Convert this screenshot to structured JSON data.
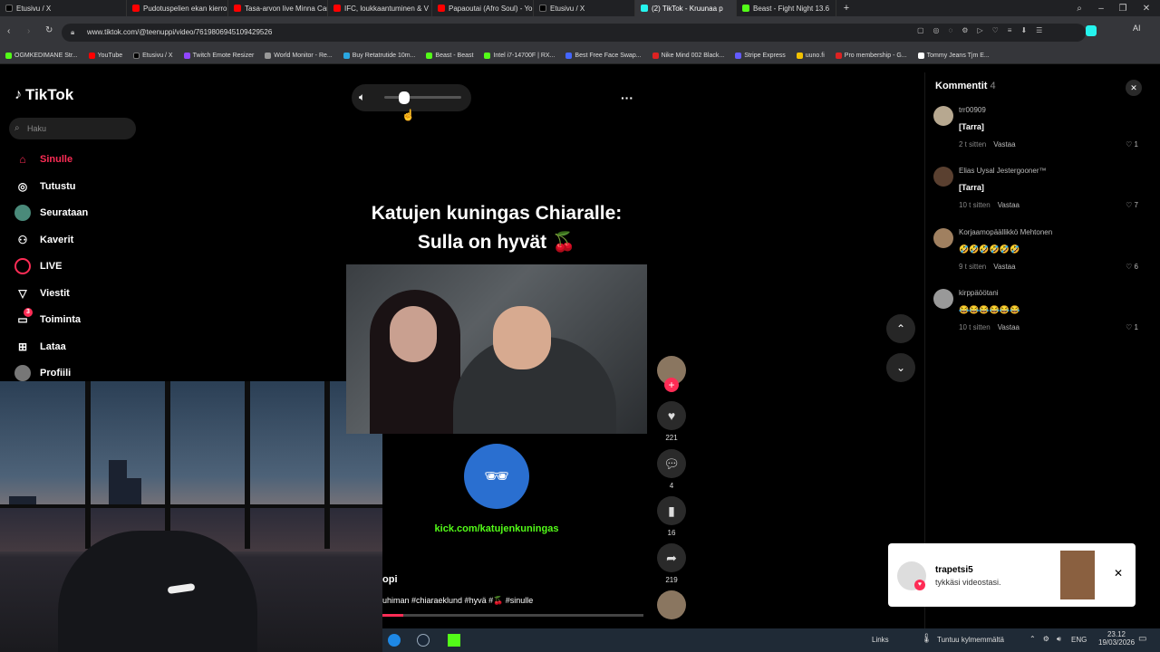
{
  "browser": {
    "tabs": [
      {
        "label": "Etusivu / X",
        "color": "#000000",
        "icon": "x-logo-icon"
      },
      {
        "label": "Pudotuspelien ekan kierro",
        "color": "#ff0000",
        "icon": "youtube-icon"
      },
      {
        "label": "Tasa-arvon live Minna Can",
        "color": "#ff0000",
        "icon": "youtube-icon"
      },
      {
        "label": "IFC, loukkaantuminen & V",
        "color": "#ff0000",
        "icon": "youtube-icon"
      },
      {
        "label": "Papaoutai (Afro Soul) - Yo",
        "color": "#ff0000",
        "icon": "youtube-icon"
      },
      {
        "label": "Etusivu / X",
        "color": "#000000",
        "icon": "x-logo-icon"
      },
      {
        "label": "(2) TikTok - Kruunaa p",
        "color": "#25f4ee",
        "icon": "tiktok-icon"
      },
      {
        "label": "Beast - Fight Night 13.6",
        "color": "#53fc18",
        "icon": "beast-icon"
      }
    ],
    "url": "www.tiktok.com/@teenuppi/video/7619806945109429526",
    "bookmarks": [
      {
        "label": "OGMKEDIMANE Str...",
        "color": "#53fc18"
      },
      {
        "label": "YouTube",
        "color": "#ff0000"
      },
      {
        "label": "Etusivu / X",
        "color": "#000000"
      },
      {
        "label": "Twitch Emote Resizer",
        "color": "#9146ff"
      },
      {
        "label": "World Monitor - Re...",
        "color": "#999999"
      },
      {
        "label": "Buy Retatrutide 10m...",
        "color": "#2aa7e1"
      },
      {
        "label": "Beast - Beast",
        "color": "#53fc18"
      },
      {
        "label": "Intel i7-14700F | RX...",
        "color": "#53fc18"
      },
      {
        "label": "Best Free Face Swap...",
        "color": "#4466ff"
      },
      {
        "label": "Nike Mind 002 Black...",
        "color": "#dd2222"
      },
      {
        "label": "Stripe Express",
        "color": "#635bff"
      },
      {
        "label": "uuno.fi",
        "color": "#f2c200"
      },
      {
        "label": "Pro membership - G...",
        "color": "#dd2222"
      },
      {
        "label": "Tommy Jeans Tjm E...",
        "color": "#ffffff"
      }
    ]
  },
  "tiktok": {
    "logo": "TikTok",
    "search_placeholder": "Haku",
    "nav": [
      {
        "label": "Sinulle",
        "icon": "home-icon",
        "active": true
      },
      {
        "label": "Tutustu",
        "icon": "compass-icon"
      },
      {
        "label": "Seurataan",
        "icon": "following-avatar-icon"
      },
      {
        "label": "Kaverit",
        "icon": "friends-icon"
      },
      {
        "label": "LIVE",
        "icon": "live-icon"
      },
      {
        "label": "Viestit",
        "icon": "messages-icon"
      },
      {
        "label": "Toiminta",
        "icon": "activity-icon",
        "badge": "3"
      },
      {
        "label": "Lataa",
        "icon": "upload-icon"
      },
      {
        "label": "Profiili",
        "icon": "profile-icon"
      }
    ],
    "video": {
      "title_line1": "Katujen kuningas Chiaralle:",
      "title_line2": "Sulla on hyvät 🍒",
      "kick_link": "kick.com/katujenkuningas",
      "author_partial": "opi",
      "caption_partial": "uhiman #chiaraeklund #hyvä #🍒 #sinulle",
      "volume_level": 0.15
    },
    "actions": {
      "likes": "221",
      "comments": "4",
      "saves": "16",
      "shares": "219"
    },
    "comments_panel": {
      "title": "Kommentit",
      "count": "4",
      "items": [
        {
          "user": "trr00909",
          "text": "[Tarra]",
          "time": "2 t sitten",
          "reply": "Vastaa",
          "likes": "1"
        },
        {
          "user": "Elias Uysal Jestergooner™",
          "text": "[Tarra]",
          "time": "10 t sitten",
          "reply": "Vastaa",
          "likes": "7"
        },
        {
          "user": "Korjaamopäällikkö Mehtonen",
          "text": "🤣🤣🤣🤣🤣🤣",
          "time": "9 t sitten",
          "reply": "Vastaa",
          "likes": "6"
        },
        {
          "user": "kirppäöötani",
          "text": "😂😂😂😂😂😂",
          "time": "10 t sitten",
          "reply": "Vastaa",
          "likes": "1"
        }
      ]
    },
    "notification": {
      "user": "trapetsi5",
      "message": "tykkäsi videostasi."
    }
  },
  "taskbar": {
    "links": "Links",
    "weather": "Tuntuu kylmemmältä",
    "lang": "ENG",
    "time": "23.12",
    "date": "19/03/2026"
  }
}
